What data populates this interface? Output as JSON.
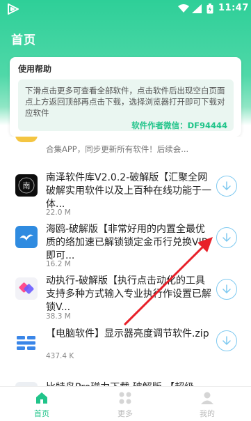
{
  "statusbar": {
    "time": "11:47"
  },
  "header": {
    "title": "首页"
  },
  "help": {
    "title": "使用帮助",
    "text": "下滑点击更多可查看全部软件，点击软件后出现空白页面点上方返回顶部再点击下载，选择浏览器打开即可下载对应软件",
    "author": "软件作者微信：DF94444"
  },
  "partial_item": {
    "text": "合集APP，同步更新所有软件！后续会..."
  },
  "items": [
    {
      "title": "南泽软件库V2.0.2-破解版【汇聚全网破解实用软件以及上百种在线功能于一体...",
      "size": "22.0 M",
      "icon": "nanze-icon"
    },
    {
      "title": "海鸥-破解版【非常好用的内置全最优质的络加速已解锁锁定金币行兑换VIP即可...",
      "size": "16.2 M",
      "icon": "seagull-icon"
    },
    {
      "title": "动执行-破解版【执行点击动化的工具支持多种方式输入专业执行作设置已解锁V...",
      "size": "38.3 M",
      "icon": "autoexec-icon"
    },
    {
      "title": "【电脑软件】显示器亮度调节软件.zip",
      "size": "437.4 K",
      "icon": "zip-icon"
    }
  ],
  "bottom_partial": {
    "text": "比特鸟Pro磁力下载 破解版 【超级"
  },
  "tabs": [
    {
      "label": "首页",
      "icon": "home-icon",
      "active": true
    },
    {
      "label": "更多",
      "icon": "grid-icon",
      "active": false
    },
    {
      "label": "我的",
      "icon": "user-icon",
      "active": false
    }
  ],
  "colors": {
    "accent": "#21c48a",
    "header": "#2ecf98",
    "download_ring": "#7ec9f0",
    "arrow": "#e8212a"
  }
}
